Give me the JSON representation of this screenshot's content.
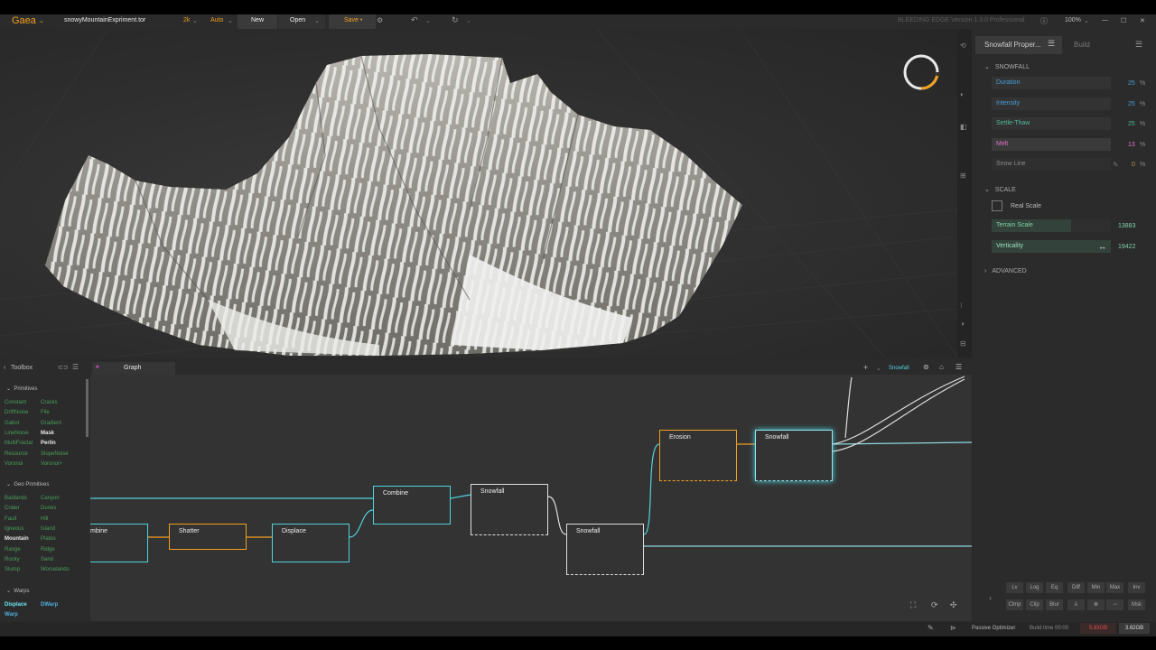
{
  "titlebar": {
    "app": "Gaea",
    "file": "snowyMountainExpriment.tor",
    "resolution": "2k",
    "build_mode": "Auto",
    "new_label": "New",
    "open_label": "Open",
    "save_label": "Save •",
    "edition": "BLEEDING EDGE Version 1.3.0 Professional",
    "zoom": "100%"
  },
  "properties": {
    "tab_label": "Snowfall Proper...",
    "build_tab": "Build",
    "snowfall_section": "SNOWFALL",
    "fields": [
      {
        "label": "Duration",
        "value": "25",
        "unit": "%",
        "color": "#4a9fd8"
      },
      {
        "label": "Intensity",
        "value": "25",
        "unit": "%",
        "color": "#4a9fd8"
      },
      {
        "label": "Settle-Thaw",
        "value": "25",
        "unit": "%",
        "color": "#4fb89a"
      },
      {
        "label": "Melt",
        "value": "13",
        "unit": "%",
        "color": "#e070c8"
      },
      {
        "label": "Snow Line",
        "value": "0",
        "unit": "%",
        "color": "#8c8c8c"
      }
    ],
    "scale_section": "SCALE",
    "real_scale_label": "Real Scale",
    "terrain_scale_label": "Terrain Scale",
    "terrain_scale_value": "13883",
    "verticality_label": "Verticality",
    "verticality_value": "19422",
    "advanced_section": "ADVANCED",
    "math_buttons_row1": [
      "Lv",
      "Log",
      "Eq",
      "Diff",
      "Min",
      "Max",
      "Inv"
    ],
    "math_buttons_row2": [
      "Clmp",
      "Clip",
      "Blur",
      "⅄",
      "⊗",
      "∽",
      "Msk"
    ]
  },
  "toolbox": {
    "title": "Toolbox",
    "primitives_label": "Primitives",
    "primitives": [
      "Constant",
      "Cracks",
      "DriftNoise",
      "File",
      "Gabor",
      "Gradient",
      "LineNoise",
      "Mask",
      "MultiFractal",
      "Perlin",
      "Resource",
      "SlopeNoise",
      "Voronoi",
      "Voronoi+"
    ],
    "geo_label": "Geo Primitives",
    "geo": [
      "Badlands",
      "Canyon",
      "Crater",
      "Dunes",
      "Fault",
      "Hill",
      "Igneous",
      "Island",
      "Mountain",
      "Plates",
      "Range",
      "Ridge",
      "Rocky",
      "Sand",
      "Slump",
      "Worselands"
    ],
    "warps_label": "Warps",
    "warps": [
      "Displace",
      "DWarp",
      "Warp"
    ]
  },
  "graph": {
    "tab_label": "Graph",
    "active_node": "Snowfall",
    "nodes": [
      "mbine",
      "Shatter",
      "Displace",
      "Combine",
      "Snowfall",
      "Snowfall",
      "Erosion",
      "Snowfall"
    ]
  },
  "status": {
    "optimizer": "Passive Optimizer",
    "build_time": "Build time 00:00",
    "memory_used": "5.83GB",
    "memory_free": "3.62GB"
  },
  "colors": {
    "accent": "#f0a020",
    "node_cyan": "#4fd3de",
    "node_orange": "#f0a020",
    "node_white": "#dddddd"
  }
}
